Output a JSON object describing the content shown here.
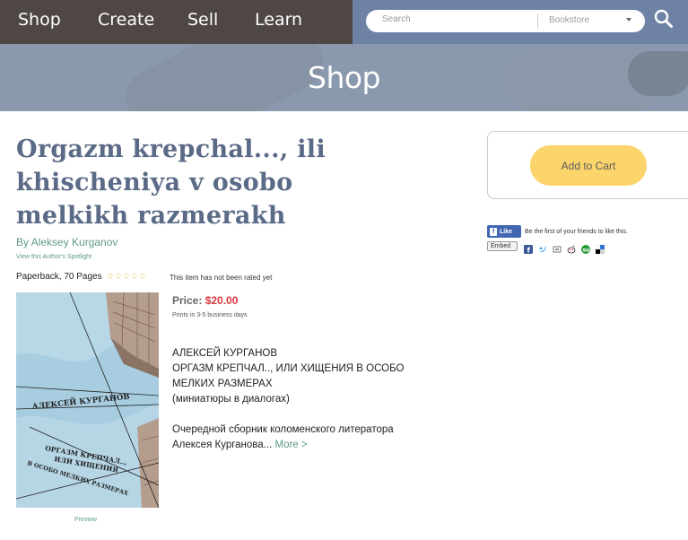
{
  "nav": {
    "items": [
      {
        "label": "Shop"
      },
      {
        "label": "Create"
      },
      {
        "label": "Sell"
      },
      {
        "label": "Learn"
      }
    ],
    "search_placeholder": "Search",
    "search_scope": "Bookstore"
  },
  "banner": {
    "title": "Shop"
  },
  "book": {
    "title": "Orgazm krepchal..., ili khischeniya v osobo melkikh razmerakh",
    "author": "By Aleksey Kurganov",
    "spotlight": "View this Author's Spotlight",
    "format": "Paperback, 70 Pages",
    "rating_text": "This item has not been rated yet",
    "stars_filled": 0,
    "stars_total": 5,
    "price_label": "Price:",
    "price": "$20.00",
    "shipping": "Prints in 3-5 business days",
    "description_lines": [
      "АЛЕКСЕЙ КУРГАНОВ",
      "ОРГАЗМ КРЕПЧАЛ.., ИЛИ ХИЩЕНИЯ В ОСОБО",
      "МЕЛКИХ РАЗМЕРАХ",
      "(миниатюры в диалогах)",
      "",
      "Очередной сборник коломенского литератора",
      "Алексея Курганова..."
    ],
    "more_label": "More >",
    "preview_label": "Preview",
    "cover_author": "АЛЕКСЕЙ КУРГАНОВ",
    "cover_title_lines": [
      "ОРГАЗМ КРЕПЧАЛ..,",
      "ИЛИ ХИЩЕНИЯ",
      "В ОСОБО МЕЛКИХ РАЗМЕРАХ"
    ]
  },
  "cart": {
    "button_label": "Add to Cart"
  },
  "social": {
    "like_label": "Like",
    "like_text": "Be the first of your friends to like this.",
    "embed_label": "Embed"
  },
  "colors": {
    "nav_left": "#4f4745",
    "nav_right": "#6e82a6",
    "title": "#5b6a86",
    "link": "#5e9a8c",
    "price": "#d9363e",
    "cart_button": "#fbd46b"
  }
}
